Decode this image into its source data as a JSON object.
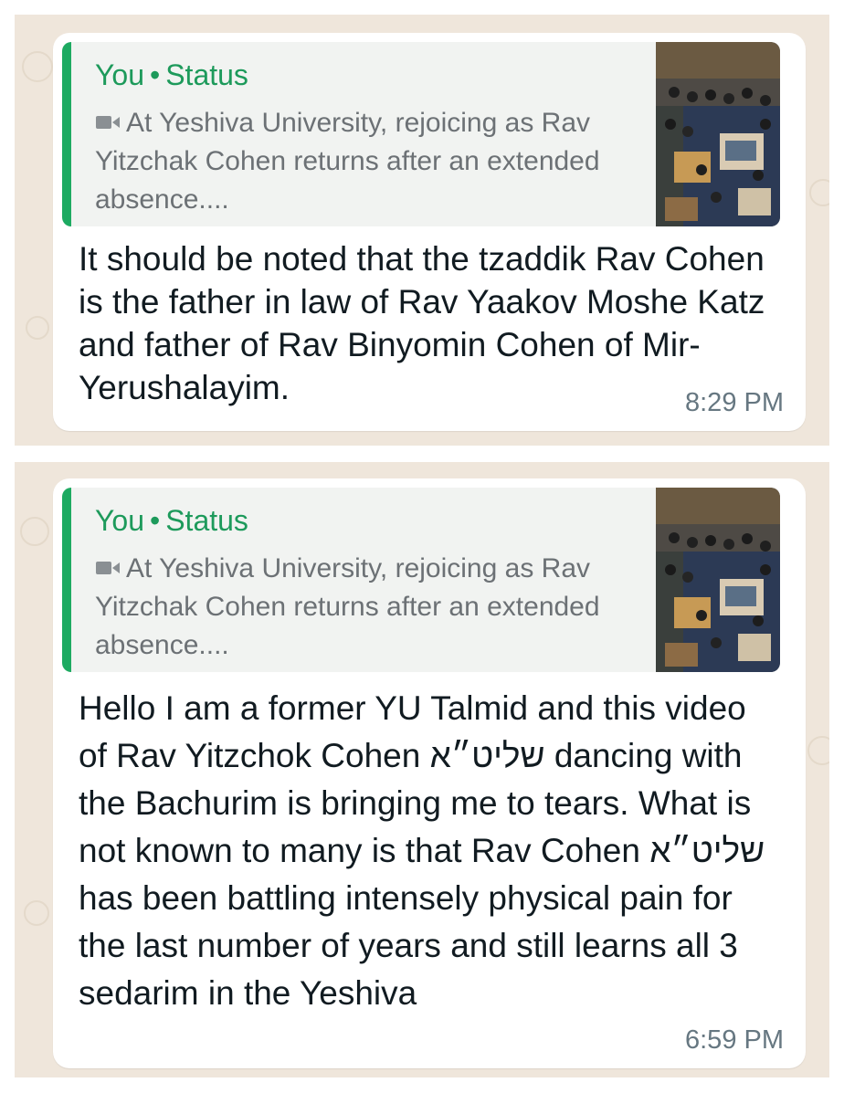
{
  "messages": [
    {
      "quote": {
        "author": "You",
        "source": "Status",
        "media_icon": "video-camera-icon",
        "text": "At Yeshiva University, rejoicing as Rav Yitzchak Cohen returns after an extended absence...."
      },
      "body": "It should be noted that the tzaddik Rav Cohen is the father in law of Rav Yaakov Moshe Katz and father of Rav Binyomin Cohen of Mir-Yerushalayim.",
      "time": "8:29 PM"
    },
    {
      "quote": {
        "author": "You",
        "source": "Status",
        "media_icon": "video-camera-icon",
        "text": "At Yeshiva University, rejoicing as Rav Yitzchak Cohen returns after an extended absence...."
      },
      "body": "Hello I am a former YU Talmid and this video of Rav Yitzchok Cohen שליט״א dancing with the Bachurim is bringing me to tears. What is not known to many is that Rav Cohen שליט״א has been battling intensely physical pain for the last number of years and still learns all 3 sedarim in the Yeshiva",
      "time": "6:59 PM"
    }
  ],
  "colors": {
    "wallpaper": "#efe6db",
    "bubble": "#ffffff",
    "quote_background": "#f1f3f1",
    "quote_accent": "#1daa61",
    "quote_author": "#1d9a5b",
    "quote_text": "#6c7175",
    "body_text": "#111b21",
    "timestamp": "#667781"
  }
}
